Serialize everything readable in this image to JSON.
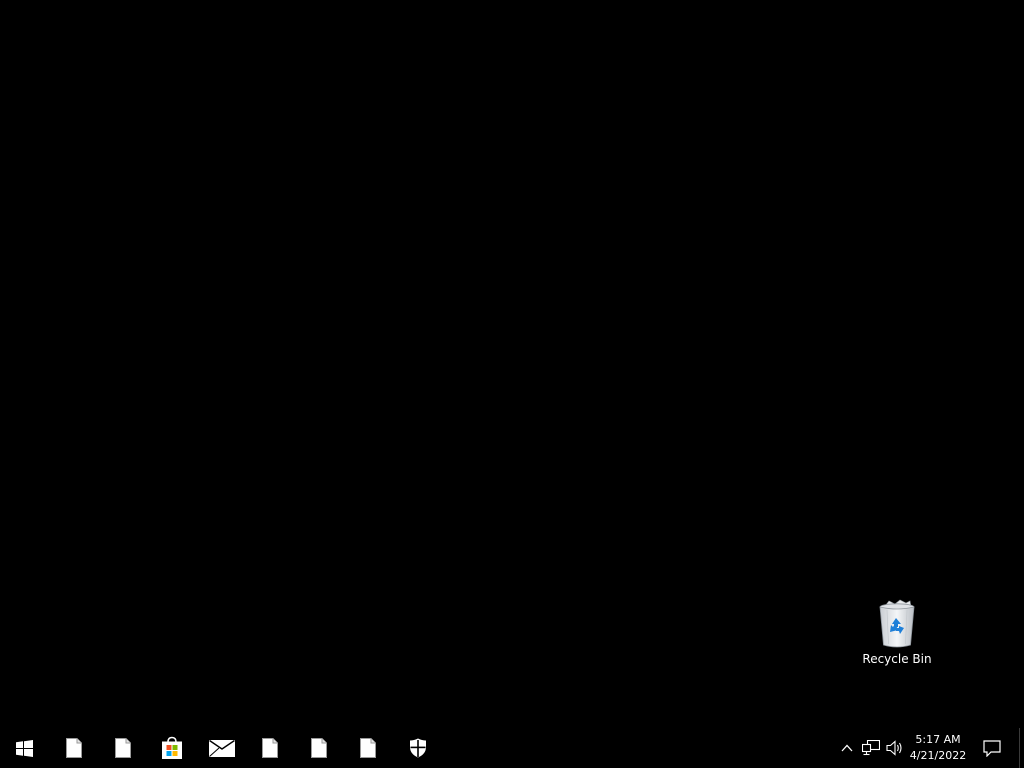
{
  "desktop": {
    "icons": [
      {
        "label": "Recycle Bin",
        "icon": "recycle-bin-icon"
      }
    ]
  },
  "taskbar": {
    "pinned": [
      {
        "name": "start",
        "icon": "windows-logo-icon"
      },
      {
        "name": "app-1",
        "icon": "blank-document-icon"
      },
      {
        "name": "app-2",
        "icon": "blank-document-icon"
      },
      {
        "name": "store",
        "icon": "microsoft-store-icon"
      },
      {
        "name": "mail",
        "icon": "mail-icon"
      },
      {
        "name": "app-5",
        "icon": "blank-document-icon"
      },
      {
        "name": "app-6",
        "icon": "blank-document-icon"
      },
      {
        "name": "app-7",
        "icon": "blank-document-icon"
      },
      {
        "name": "security",
        "icon": "shield-icon"
      }
    ],
    "tray": {
      "icons": [
        "chevron-up-icon",
        "network-icon",
        "volume-icon"
      ],
      "time": "5:17 AM",
      "date": "4/21/2022",
      "notifications_icon": "action-center-icon"
    }
  },
  "colors": {
    "desktop_background": "#000000",
    "taskbar_background": "#000000",
    "text": "#ffffff",
    "store_red": "#f25022",
    "store_green": "#7fba00",
    "store_blue": "#00a4ef",
    "store_yellow": "#ffb900",
    "recycle_blue": "#1e90ff"
  }
}
